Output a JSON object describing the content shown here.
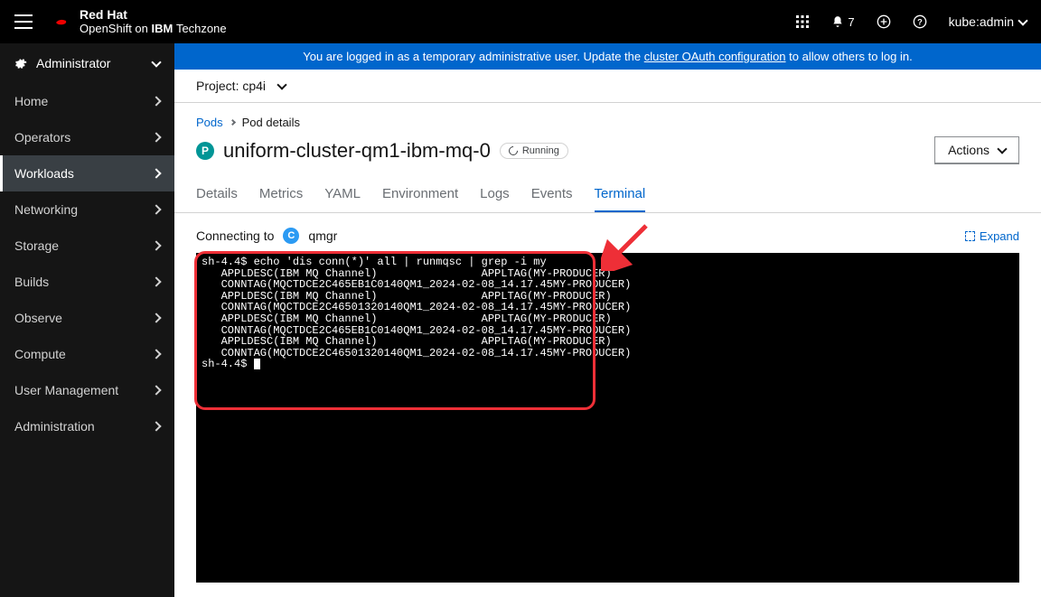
{
  "brand": {
    "top": "Red Hat",
    "sub_pre": "OpenShift on ",
    "sub_bold": "IBM ",
    "sub_tail": "Techzone"
  },
  "topbar": {
    "notif_count": "7",
    "username": "kube:admin"
  },
  "banner": {
    "pre": "You are logged in as a temporary administrative user. Update the ",
    "link": "cluster OAuth configuration",
    "post": " to allow others to log in."
  },
  "sidebar": {
    "admin": "Administrator",
    "items": [
      "Home",
      "Operators",
      "Workloads",
      "Networking",
      "Storage",
      "Builds",
      "Observe",
      "Compute",
      "User Management",
      "Administration"
    ]
  },
  "project_bar": {
    "label": "Project: cp4i"
  },
  "breadcrumb": {
    "root": "Pods",
    "current": "Pod details"
  },
  "title": {
    "badge": "P",
    "name": "uniform-cluster-qm1-ibm-mq-0",
    "status": "Running",
    "actions": "Actions"
  },
  "tabs": [
    "Details",
    "Metrics",
    "YAML",
    "Environment",
    "Logs",
    "Events",
    "Terminal"
  ],
  "terminal_header": {
    "connecting": "Connecting to",
    "container_badge": "C",
    "container": "qmgr",
    "expand": "Expand"
  },
  "terminal": {
    "line1": "sh-4.4$ echo 'dis conn(*)' all | runmqsc | grep -i my",
    "line2": "   APPLDESC(IBM MQ Channel)                APPLTAG(MY-PRODUCER)",
    "line3": "   CONNTAG(MQCTDCE2C465EB1C0140QM1_2024-02-08_14.17.45MY-PRODUCER)",
    "line4": "   APPLDESC(IBM MQ Channel)                APPLTAG(MY-PRODUCER)",
    "line5": "   CONNTAG(MQCTDCE2C46501320140QM1_2024-02-08_14.17.45MY-PRODUCER)",
    "line6": "   APPLDESC(IBM MQ Channel)                APPLTAG(MY-PRODUCER)",
    "line7": "   CONNTAG(MQCTDCE2C465EB1C0140QM1_2024-02-08_14.17.45MY-PRODUCER)",
    "line8": "   APPLDESC(IBM MQ Channel)                APPLTAG(MY-PRODUCER)",
    "line9": "   CONNTAG(MQCTDCE2C46501320140QM1_2024-02-08_14.17.45MY-PRODUCER)",
    "prompt": "sh-4.4$ "
  }
}
